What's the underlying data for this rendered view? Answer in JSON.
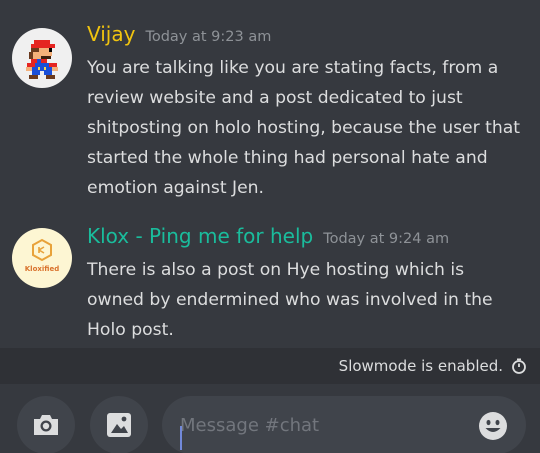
{
  "channel": {
    "messages": [
      {
        "author": "Vijay",
        "author_color": "#f1c40f",
        "timestamp": "Today at 9:23 am",
        "avatar_icon": "mario-pixel-avatar",
        "lines": [
          "You are talking like you are stating facts, from a",
          "review website and a post dedicated to just",
          "shitposting on holo hosting, because the user that",
          "started the whole thing had personal hate and",
          "emotion against Jen."
        ]
      },
      {
        "author": "Klox - Ping me for help",
        "author_color": "#1abc9c",
        "timestamp": "Today at 9:24 am",
        "avatar_icon": "kloxified-logo-avatar",
        "avatar_text": "Kloxified",
        "lines": [
          "There is also a post on Hye hosting which is",
          "owned by endermined who was involved in the",
          "Holo post."
        ]
      }
    ]
  },
  "slowmode": {
    "text": "Slowmode is enabled.",
    "icon": "timer-icon"
  },
  "composer": {
    "placeholder": "Message #chat",
    "camera_icon": "camera-icon",
    "gallery_icon": "image-icon",
    "emoji_icon": "emoji-icon"
  },
  "theme": {
    "background": "#36393f",
    "bar": "#2f3136",
    "input": "#40444b",
    "text": "#dcddde",
    "muted": "#8e9297"
  }
}
